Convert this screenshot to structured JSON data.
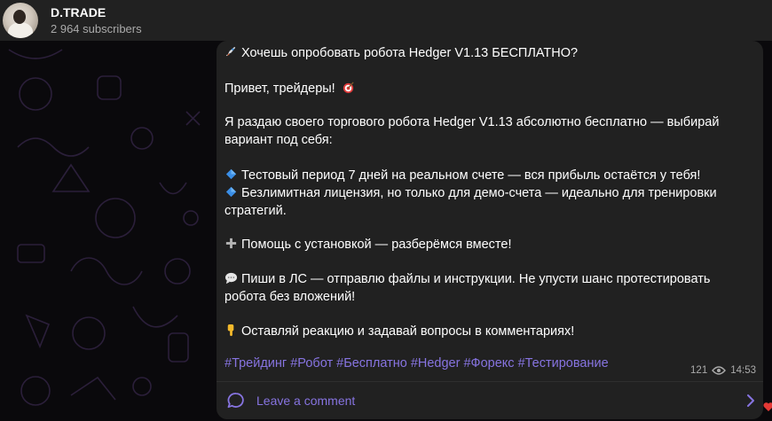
{
  "header": {
    "title": "D.TRADE",
    "subscribers": "2 964 subscribers",
    "avatar_icon": "channel-avatar"
  },
  "message": {
    "lines": [
      {
        "emoji": "rocket-icon",
        "text": "Хочешь опробовать робота Hedger V1.13 БЕСПЛАТНО?"
      },
      {
        "emoji": "",
        "text": "Привет, трейдеры!",
        "trailing_emoji": "target-icon"
      },
      {
        "emoji": "",
        "text": "Я раздаю своего торгового робота Hedger V1.13 абсолютно бесплатно — выбирай"
      },
      {
        "emoji": "",
        "text": "вариант под себя:"
      },
      {
        "emoji": "blue-diamond-icon",
        "text": "Тестовый период 7 дней на реальном счете — вся прибыль остаётся у тебя!"
      },
      {
        "emoji": "blue-diamond-icon",
        "text": "Безлимитная лицензия, но только для демо-счета — идеально для тренировки"
      },
      {
        "emoji": "",
        "text": "стратегий."
      },
      {
        "emoji": "plus-icon",
        "text": "Помощь с установкой — разберёмся вместе!"
      },
      {
        "emoji": "speech-bubble-icon",
        "text": "Пиши в ЛС — отправлю файлы и инструкции. Не упусти шанс протестировать"
      },
      {
        "emoji": "",
        "text": "робота без вложений!"
      },
      {
        "emoji": "pointing-down-icon",
        "text": "Оставляй реакцию и задавай вопросы в комментариях!"
      }
    ],
    "hashtags": [
      "#Трейдинг",
      "#Робот",
      "#Бесплатно",
      "#Hedger",
      "#Форекс",
      "#Тестирование"
    ],
    "views": "121",
    "time": "14:53"
  },
  "comments": {
    "label": "Leave a comment"
  },
  "colors": {
    "accent": "#8774e1",
    "bubble": "#212121",
    "background": "#0a090c"
  }
}
